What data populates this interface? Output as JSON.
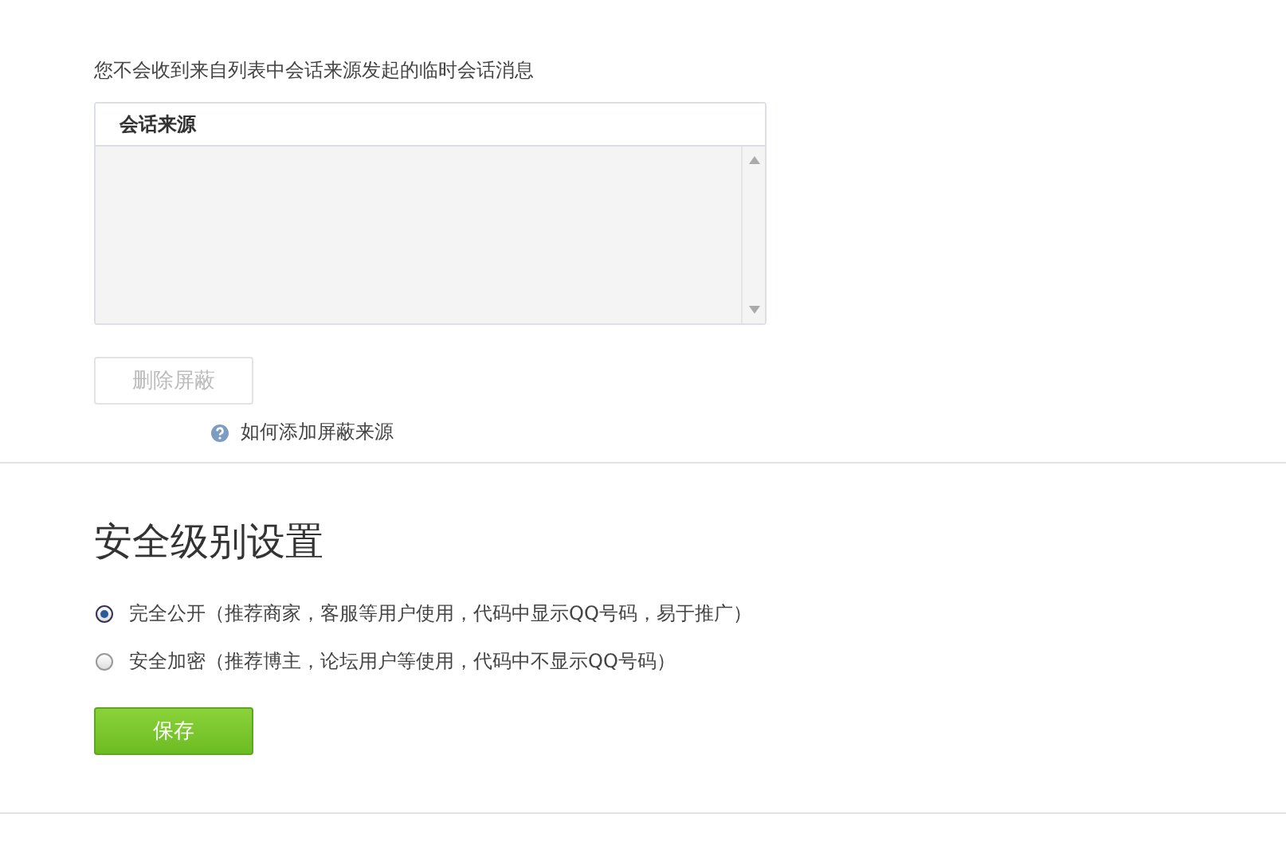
{
  "notice": "您不会收到来自列表中会话来源发起的临时会话消息",
  "source_table": {
    "columns": [
      "会话来源"
    ]
  },
  "delete_button": {
    "label": "删除屏蔽",
    "disabled": true
  },
  "help_link": "如何添加屏蔽来源",
  "security": {
    "title": "安全级别设置",
    "options": [
      {
        "label": "完全公开（推荐商家，客服等用户使用，代码中显示QQ号码，易于推广）",
        "selected": true
      },
      {
        "label": "安全加密（推荐博主，论坛用户等使用，代码中不显示QQ号码）",
        "selected": false
      }
    ],
    "save_button": "保存"
  }
}
